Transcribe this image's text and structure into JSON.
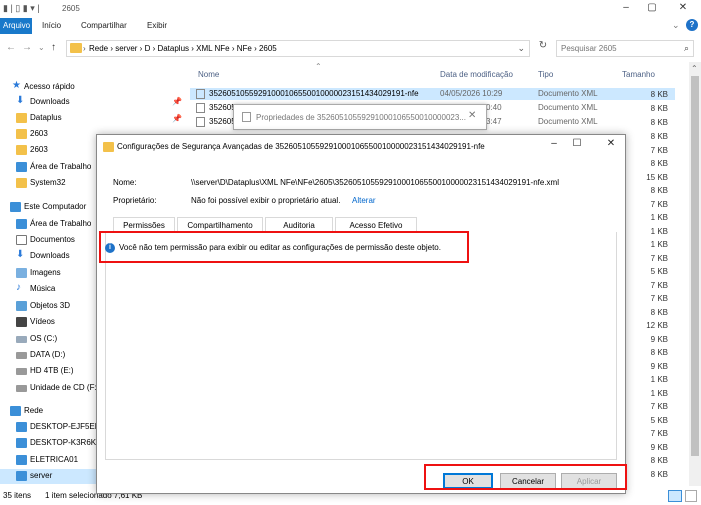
{
  "window": {
    "title": "2605"
  },
  "ribbon": {
    "file": "Arquivo",
    "home": "Início",
    "share": "Compartilhar",
    "view": "Exibir"
  },
  "address": {
    "crumbs": "Rede  ›  server  ›  D  ›  Dataplus  ›  XML NFe  ›  NFe  ›  2605",
    "search_placeholder": "Pesquisar 2605"
  },
  "nav": {
    "quick": "Acesso rápido",
    "downloads": "Downloads",
    "dataplus": "Dataplus",
    "f2603": "2603",
    "f2603b": "2603",
    "desktop": "Área de Trabalho",
    "system32": "System32",
    "thispc": "Este Computador",
    "desktop2": "Área de Trabalho",
    "documents": "Documentos",
    "downloads2": "Downloads",
    "images": "Imagens",
    "music": "Música",
    "objects3d": "Objetos 3D",
    "videos": "Vídeos",
    "osc": "OS (C:)",
    "datad": "DATA (D:)",
    "hde": "HD 4TB (E:)",
    "cdf": "Unidade de CD (F:",
    "network": "Rede",
    "pc1": "DESKTOP-EJF5EF9",
    "pc2": "DESKTOP-K3R6KM",
    "pc3": "ELETRICA01",
    "server": "server"
  },
  "columns": {
    "name": "Nome",
    "date": "Data de modificação",
    "type": "Tipo",
    "size": "Tamanho"
  },
  "files": [
    {
      "name": "35260510559291000106550010000023151434029191-nfe",
      "date": "04/05/2026 10:29",
      "type": "Documento XML",
      "size": "8 KB"
    },
    {
      "name": "352605",
      "date": "0:40",
      "type": "Documento XML",
      "size": "8 KB"
    },
    {
      "name": "352605",
      "date": "3:47",
      "type": "Documento XML",
      "size": "8 KB"
    }
  ],
  "sizes": [
    "8 KB",
    "7 KB",
    "8 KB",
    "15 KB",
    "8 KB",
    "7 KB",
    "1 KB",
    "1 KB",
    "1 KB",
    "7 KB",
    "5 KB",
    "7 KB",
    "7 KB",
    "8 KB",
    "12 KB",
    "9 KB",
    "8 KB",
    "9 KB",
    "1 KB",
    "1 KB",
    "7 KB",
    "5 KB",
    "7 KB",
    "9 KB",
    "8 KB",
    "8 KB"
  ],
  "status": {
    "count": "35 itens",
    "selected": "1 item selecionado  7,61 KB"
  },
  "prop_dialog": {
    "title": "Propriedades de 35260510559291000106550010000023..."
  },
  "dialog": {
    "title": "Configurações de Segurança Avançadas de 35260510559291000106550010000023151434029191-nfe",
    "name_label": "Nome:",
    "name_value": "\\\\server\\D\\Dataplus\\XML NFe\\NFe\\2605\\35260510559291000106550010000023151434029191-nfe.xml",
    "owner_label": "Proprietário:",
    "owner_value": "Não foi possível exibir o proprietário atual.",
    "owner_change": "Alterar",
    "tabs": [
      "Permissões",
      "Compartilhamento",
      "Auditoria",
      "Acesso Efetivo"
    ],
    "message": "Você não tem permissão para exibir ou editar as configurações de permissão deste objeto.",
    "ok": "OK",
    "cancel": "Cancelar",
    "apply": "Aplicar"
  },
  "colors": {
    "accent": "#0078d7",
    "highlight": "#e11111",
    "selection": "#cce8ff"
  }
}
